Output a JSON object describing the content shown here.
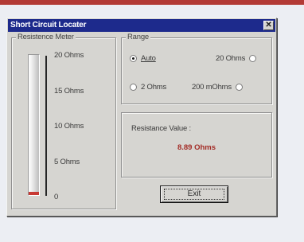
{
  "window": {
    "title": "Short Circuit Locater",
    "close_glyph": "✕"
  },
  "meter": {
    "legend": "Resistence Meter",
    "scale": [
      "20 Ohms",
      "15 Ohms",
      "10 Ohms",
      "5 Ohms",
      "0"
    ],
    "level_fraction": 0.02
  },
  "range": {
    "legend": "Range",
    "options": [
      {
        "label": "Auto",
        "selected": true
      },
      {
        "label": "20 Ohms",
        "selected": false
      },
      {
        "label": "2 Ohms",
        "selected": false
      },
      {
        "label": "200 mOhms",
        "selected": false
      }
    ]
  },
  "value": {
    "caption": "Resistance Value :",
    "reading": "8.89 Ohms",
    "color": "#a32c26"
  },
  "exit_label": "Exit",
  "colors": {
    "titlebar": "#1d2a8c",
    "window_face": "#d6d5d1",
    "accent_bar": "#b33a35"
  }
}
